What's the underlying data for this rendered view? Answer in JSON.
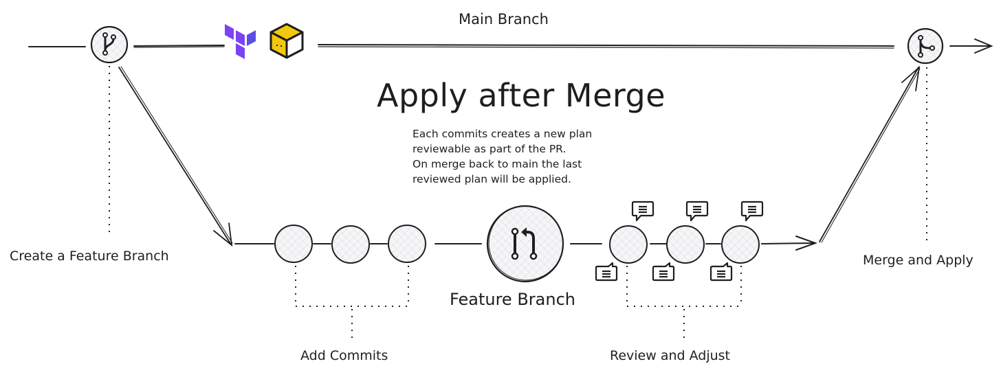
{
  "diagram": {
    "title": "Apply after Merge",
    "description_lines": [
      "Each commits creates a new plan",
      "reviewable as part of the PR.",
      "On merge back to main the last",
      "reviewed plan will be applied."
    ],
    "main_branch_label": "Main Branch",
    "create_branch_label": "Create a Feature Branch",
    "merge_apply_label": "Merge and Apply",
    "feature_branch_label": "Feature Branch",
    "add_commits_label": "Add Commits",
    "review_adjust_label": "Review and Adjust",
    "icons": {
      "branch_start": "git-branch-icon",
      "merge_end": "git-merge-icon",
      "pull_request": "git-pull-request-icon",
      "terraform_logo": "terraform-logo-icon",
      "box_logo": "yellow-cube-logo-icon",
      "comment": "comment-bubble-icon"
    },
    "colors": {
      "ink": "#1e1e1e",
      "terraform_purple": "#7b42f6",
      "terraform_purple_dark": "#5c4ee5",
      "cube_yellow": "#f2c80f",
      "node_fill": "#f1f1f4"
    },
    "commit_nodes": 3,
    "review_nodes": 3
  }
}
